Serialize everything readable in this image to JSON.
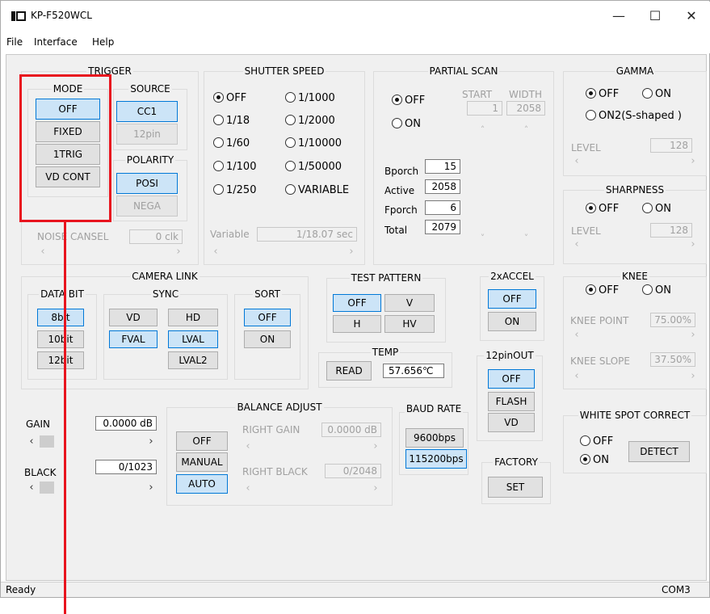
{
  "window": {
    "title": "KP-F520WCL",
    "minimize": "—",
    "maximize": "☐",
    "close": "✕"
  },
  "menu": [
    "File",
    "Interface",
    "Help"
  ],
  "trigger": {
    "title": "TRIGGER",
    "mode_title": "MODE",
    "modes": [
      "OFF",
      "FIXED",
      "1TRIG",
      "VD CONT"
    ],
    "source_title": "SOURCE",
    "sources": [
      "CC1",
      "12pin"
    ],
    "polarity_title": "POLARITY",
    "polarity": [
      "POSI",
      "NEGA"
    ],
    "noise_label": "NOISE CANSEL",
    "noise_value": "0 clk"
  },
  "shutter": {
    "title": "SHUTTER SPEED",
    "options": [
      "OFF",
      "1/1000",
      "1/18",
      "1/2000",
      "1/60",
      "1/10000",
      "1/100",
      "1/50000",
      "1/250",
      "VARIABLE"
    ],
    "variable_label": "Variable",
    "variable_value": "1/18.07 sec"
  },
  "partial": {
    "title": "PARTIAL SCAN",
    "off": "OFF",
    "on": "ON",
    "start_label": "START",
    "width_label": "WIDTH",
    "start_value": "1",
    "width_value": "2058",
    "bporch_label": "Bporch",
    "bporch": "15",
    "active_label": "Active",
    "active": "2058",
    "fporch_label": "Fporch",
    "fporch": "6",
    "total_label": "Total",
    "total": "2079"
  },
  "gamma": {
    "title": "GAMMA",
    "off": "OFF",
    "on": "ON",
    "on2": "ON2(S-shaped )",
    "level_label": "LEVEL",
    "level": "128"
  },
  "sharpness": {
    "title": "SHARPNESS",
    "off": "OFF",
    "on": "ON",
    "level_label": "LEVEL",
    "level": "128"
  },
  "camlink": {
    "title": "CAMERA LINK",
    "databit_title": "DATA BIT",
    "databits": [
      "8bit",
      "10bit",
      "12bit"
    ],
    "sync_title": "SYNC",
    "sync": [
      "VD",
      "HD",
      "FVAL",
      "LVAL",
      "LVAL2"
    ],
    "sort_title": "SORT",
    "sort": [
      "OFF",
      "ON"
    ]
  },
  "testpattern": {
    "title": "TEST PATTERN",
    "buttons": [
      "OFF",
      "V",
      "H",
      "HV"
    ]
  },
  "temp": {
    "title": "TEMP",
    "read": "READ",
    "value": "57.656℃"
  },
  "accel": {
    "title": "2xACCEL",
    "buttons": [
      "OFF",
      "ON"
    ]
  },
  "pinout": {
    "title": "12pinOUT",
    "buttons": [
      "OFF",
      "FLASH",
      "VD"
    ]
  },
  "knee": {
    "title": "KNEE",
    "off": "OFF",
    "on": "ON",
    "point_label": "KNEE POINT",
    "point": "75.00%",
    "slope_label": "KNEE SLOPE",
    "slope": "37.50%"
  },
  "gain": {
    "label": "GAIN",
    "value": "0.0000 dB"
  },
  "black": {
    "label": "BLACK",
    "value": "0/1023"
  },
  "balance": {
    "title": "BALANCE ADJUST",
    "buttons": [
      "OFF",
      "MANUAL",
      "AUTO"
    ],
    "rgain_label": "RIGHT GAIN",
    "rgain": "0.0000 dB",
    "rblack_label": "RIGHT BLACK",
    "rblack": "0/2048"
  },
  "baud": {
    "title": "BAUD RATE",
    "buttons": [
      "9600bps",
      "115200bps"
    ]
  },
  "factory": {
    "title": "FACTORY",
    "set": "SET"
  },
  "wsc": {
    "title": "WHITE SPOT CORRECT",
    "off": "OFF",
    "on": "ON",
    "detect": "DETECT"
  },
  "statusbar": {
    "left": "Ready",
    "right": "COM3"
  },
  "colors": {
    "selected_bg": "#cce4f7",
    "selected_border": "#0078d7",
    "highlight": "#e8141e"
  }
}
